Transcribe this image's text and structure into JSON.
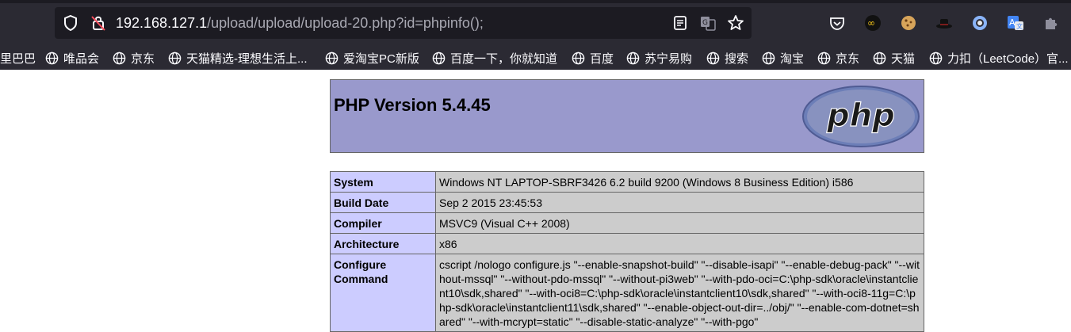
{
  "browser": {
    "url_host": "192.168.127.1",
    "url_path": "/upload/upload/upload-20.php?id=phpinfo();",
    "toolbar_icons": [
      "reader-view-icon",
      "translate-icon",
      "bookmark-star-icon",
      "pocket-icon",
      "extension-infinity-icon",
      "cookie-icon",
      "extension-hat-icon",
      "extension-circle-icon",
      "translate-extension-icon",
      "extensions-puzzle-icon"
    ]
  },
  "bookmarks": [
    {
      "label": "里巴巴"
    },
    {
      "label": "唯品会"
    },
    {
      "label": "京东"
    },
    {
      "label": "天猫精选-理想生活上..."
    },
    {
      "label": "爱淘宝PC新版"
    },
    {
      "label": "百度一下，你就知道"
    },
    {
      "label": "百度"
    },
    {
      "label": "苏宁易购"
    },
    {
      "label": "搜索"
    },
    {
      "label": "淘宝"
    },
    {
      "label": "京东"
    },
    {
      "label": "天猫"
    },
    {
      "label": "力扣（LeetCode）官..."
    }
  ],
  "php": {
    "title": "PHP Version 5.4.45",
    "logo_text": "php",
    "colors": {
      "header": "#9999cc",
      "key_cell": "#ccccff",
      "value_cell": "#cccccc"
    },
    "rows": [
      {
        "key": "System",
        "value": "Windows NT LAPTOP-SBRF3426 6.2 build 9200 (Windows 8 Business Edition) i586"
      },
      {
        "key": "Build Date",
        "value": "Sep 2 2015 23:45:53"
      },
      {
        "key": "Compiler",
        "value": "MSVC9 (Visual C++ 2008)"
      },
      {
        "key": "Architecture",
        "value": "x86"
      },
      {
        "key": "Configure Command",
        "value": "cscript /nologo configure.js \"--enable-snapshot-build\" \"--disable-isapi\" \"--enable-debug-pack\" \"--without-mssql\" \"--without-pdo-mssql\" \"--without-pi3web\" \"--with-pdo-oci=C:\\php-sdk\\oracle\\instantclient10\\sdk,shared\" \"--with-oci8=C:\\php-sdk\\oracle\\instantclient10\\sdk,shared\" \"--with-oci8-11g=C:\\php-sdk\\oracle\\instantclient11\\sdk,shared\" \"--enable-object-out-dir=../obj/\" \"--enable-com-dotnet=shared\" \"--with-mcrypt=static\" \"--disable-static-analyze\" \"--with-pgo\""
      }
    ]
  }
}
